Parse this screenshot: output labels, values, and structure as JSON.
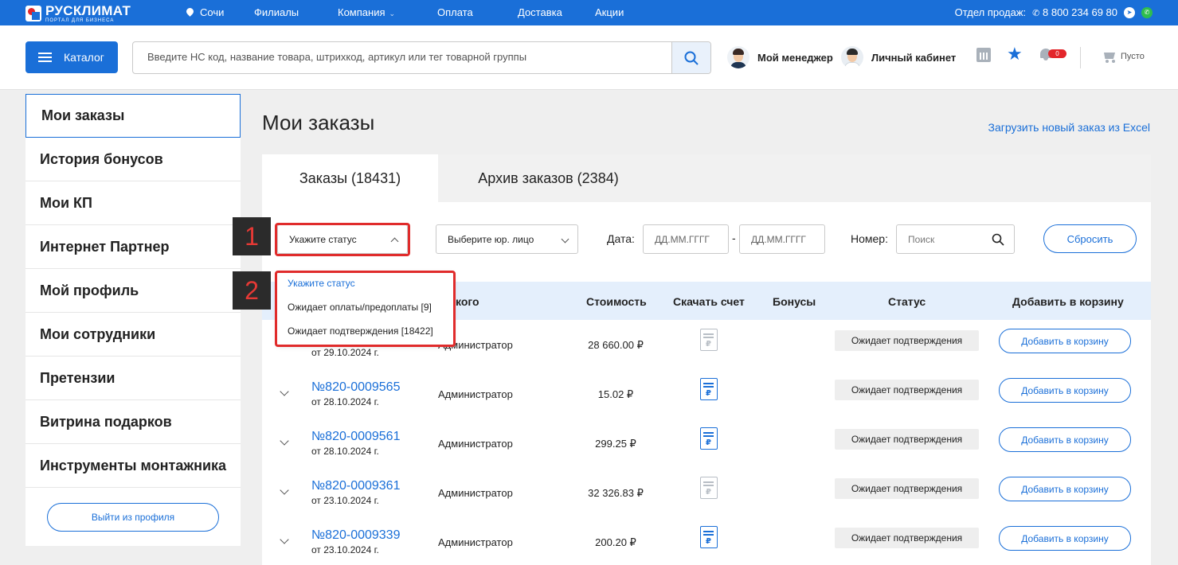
{
  "topbar": {
    "logo_title": "РУСКЛИМАТ",
    "logo_subtitle": "ПОРТАЛ ДЛЯ БИЗНЕСА",
    "city": "Сочи",
    "nav": [
      "Филиалы",
      "Компания",
      "Оплата",
      "Доставка",
      "Акции"
    ],
    "sales_label": "Отдел продаж:",
    "phone": "8 800 234 69 80"
  },
  "header": {
    "catalog_label": "Каталог",
    "search_placeholder": "Введите НС код, название товара, штрихкод, артикул или тег товарной группы",
    "manager_label": "Мой менеджер",
    "account_label": "Личный кабинет",
    "notifications_count": "0",
    "cart_label": "Пусто"
  },
  "sidebar": {
    "items": [
      "Мои заказы",
      "История бонусов",
      "Мои КП",
      "Интернет Партнер",
      "Мой профиль",
      "Мои сотрудники",
      "Претензии",
      "Витрина подарков",
      "Инструменты монтажника"
    ],
    "logout_label": "Выйти из профиля"
  },
  "main": {
    "title": "Мои заказы",
    "excel_link": "Загрузить новый заказ из Excel",
    "tabs": [
      "Заказы (18431)",
      "Архив заказов (2384)"
    ]
  },
  "filters": {
    "status_placeholder": "Укажите статус",
    "legal_placeholder": "Выберите юр. лицо",
    "date_label": "Дата:",
    "date_from_placeholder": "ДД.ММ.ГГГГ",
    "date_sep": "-",
    "date_to_placeholder": "ДД.ММ.ГГГГ",
    "number_label": "Номер:",
    "search_placeholder": "Поиск",
    "reset_label": "Сбросить"
  },
  "dropdown": {
    "options": [
      "Укажите статус",
      "Ожидает оплаты/предоплаты [9]",
      "Ожидает подтверждения [18422]"
    ]
  },
  "table": {
    "columns": [
      "кого",
      "Стоимость",
      "Скачать счет",
      "Бонусы",
      "Статус",
      "Добавить в корзину"
    ],
    "rows": [
      {
        "number": "",
        "date": "от 29.10.2024 г.",
        "author": "Администратор",
        "cost": "28 660.00 ₽",
        "invoice": "disabled",
        "bonus": "",
        "status": "Ожидает подтверждения",
        "add": "Добавить в корзину"
      },
      {
        "number": "№820-0009565",
        "date": "от 28.10.2024 г.",
        "author": "Администратор",
        "cost": "15.02 ₽",
        "invoice": "enabled",
        "bonus": "",
        "status": "Ожидает подтверждения",
        "add": "Добавить в корзину"
      },
      {
        "number": "№820-0009561",
        "date": "от 28.10.2024 г.",
        "author": "Администратор",
        "cost": "299.25 ₽",
        "invoice": "enabled",
        "bonus": "",
        "status": "Ожидает подтверждения",
        "add": "Добавить в корзину"
      },
      {
        "number": "№820-0009361",
        "date": "от 23.10.2024 г.",
        "author": "Администратор",
        "cost": "32 326.83 ₽",
        "invoice": "disabled",
        "bonus": "",
        "status": "Ожидает подтверждения",
        "add": "Добавить в корзину"
      },
      {
        "number": "№820-0009339",
        "date": "от 23.10.2024 г.",
        "author": "Администратор",
        "cost": "200.20 ₽",
        "invoice": "enabled",
        "bonus": "",
        "status": "Ожидает подтверждения",
        "add": "Добавить в корзину"
      }
    ]
  },
  "annotations": [
    "1",
    "2"
  ],
  "colors": {
    "brand_blue": "#1a6fd8",
    "annotation_red": "#e02b2b",
    "badge_red": "#e3262b",
    "header_row_bg": "#e4effc"
  }
}
